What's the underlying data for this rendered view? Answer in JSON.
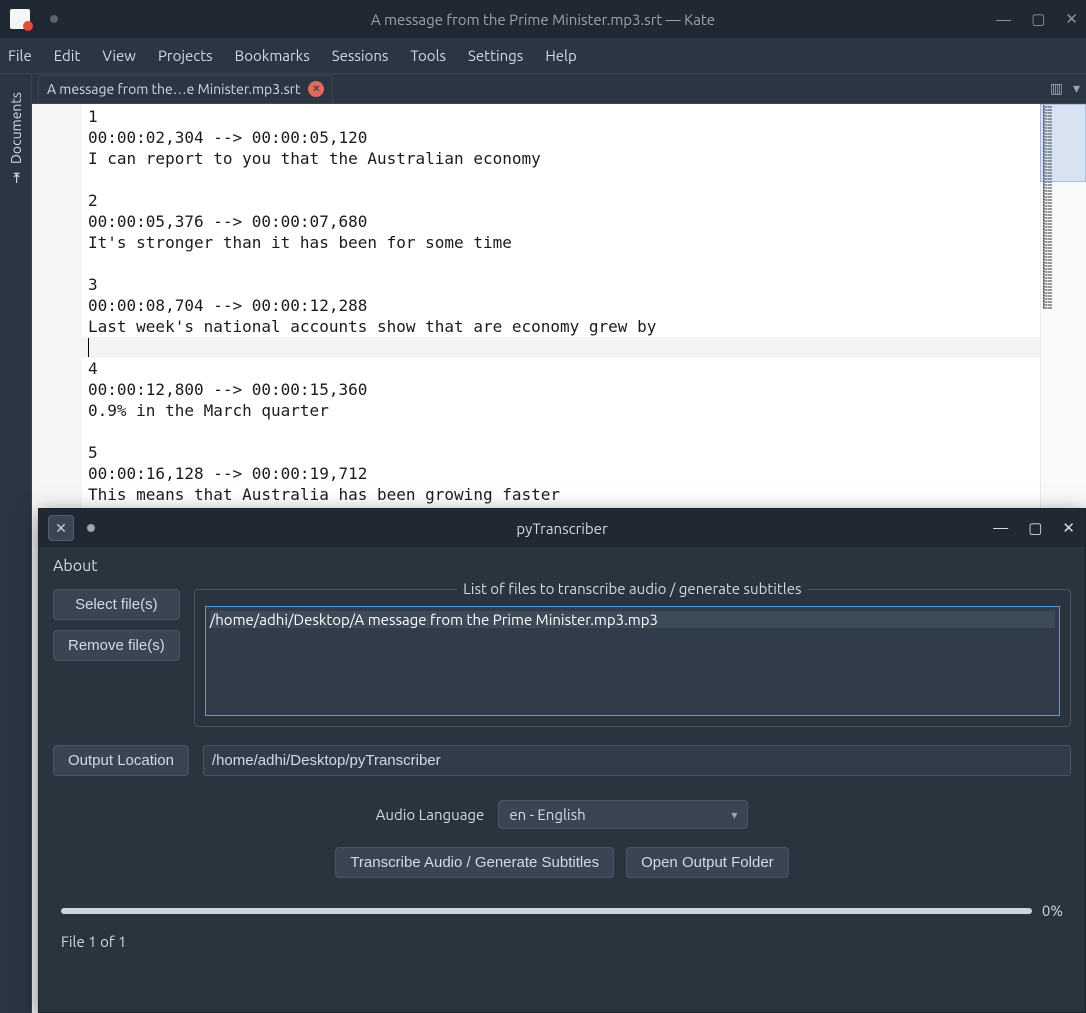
{
  "kate": {
    "title": "A message from the Prime Minister.mp3.srt — Kate",
    "menu": {
      "file": "File",
      "edit": "Edit",
      "view": "View",
      "projects": "Projects",
      "bookmarks": "Bookmarks",
      "sessions": "Sessions",
      "tools": "Tools",
      "settings": "Settings",
      "help": "Help"
    },
    "sidebar_label": "Documents",
    "tab_label": "A message from the…e Minister.mp3.srt",
    "editor_lines": [
      "1",
      "00:00:02,304 --> 00:00:05,120",
      "I can report to you that the Australian economy",
      "",
      "2",
      "00:00:05,376 --> 00:00:07,680",
      "It's stronger than it has been for some time",
      "",
      "3",
      "00:00:08,704 --> 00:00:12,288",
      "Last week's national accounts show that are economy grew by",
      "",
      "4",
      "00:00:12,800 --> 00:00:15,360",
      "0.9% in the March quarter",
      "",
      "5",
      "00:00:16,128 --> 00:00:19,712",
      "This means that Australia has been growing faster"
    ],
    "cursor_line_index": 11
  },
  "pt": {
    "title": "pyTranscriber",
    "about": "About",
    "select_files": "Select file(s)",
    "remove_files": "Remove file(s)",
    "filegroup_title": "List of files to transcribe audio / generate subtitles",
    "file_item": "/home/adhi/Desktop/A message from the Prime Minister.mp3.mp3 ",
    "output_location_btn": "Output Location",
    "output_location_path": "/home/adhi/Desktop/pyTranscriber",
    "audio_language_label": "Audio Language",
    "audio_language_value": "en - English",
    "transcribe_btn": "Transcribe Audio / Generate Subtitles",
    "open_output_btn": "Open Output Folder",
    "percent": "0%",
    "status": "File 1 of 1"
  }
}
